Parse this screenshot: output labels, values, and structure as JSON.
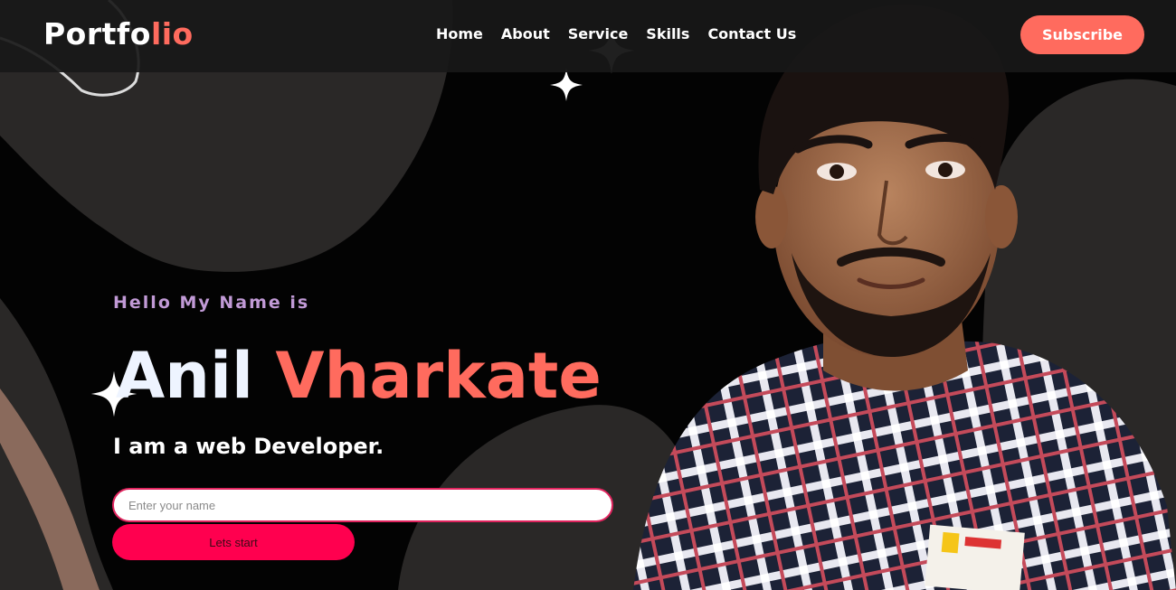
{
  "header": {
    "logo_main": "Portfo",
    "logo_accent": "lio",
    "nav": [
      "Home",
      "About",
      "Service",
      "Skills",
      "Contact Us"
    ],
    "subscribe_label": "Subscribe"
  },
  "hero": {
    "greeting": "Hello My Name is",
    "first_name": "Anil",
    "last_name": "Vharkate",
    "role": "I am a web Developer.",
    "input_placeholder": "Enter your name",
    "input_value": "",
    "cta_label": "Lets start"
  },
  "colors": {
    "accent": "#ff6b5e",
    "cta": "#ff004f",
    "input_border": "#e0245e",
    "greeting": "#c19ad6",
    "background": "#030303",
    "blob": "#2a2827"
  },
  "icons": [
    "sparkle-icon",
    "portrait-photo"
  ]
}
